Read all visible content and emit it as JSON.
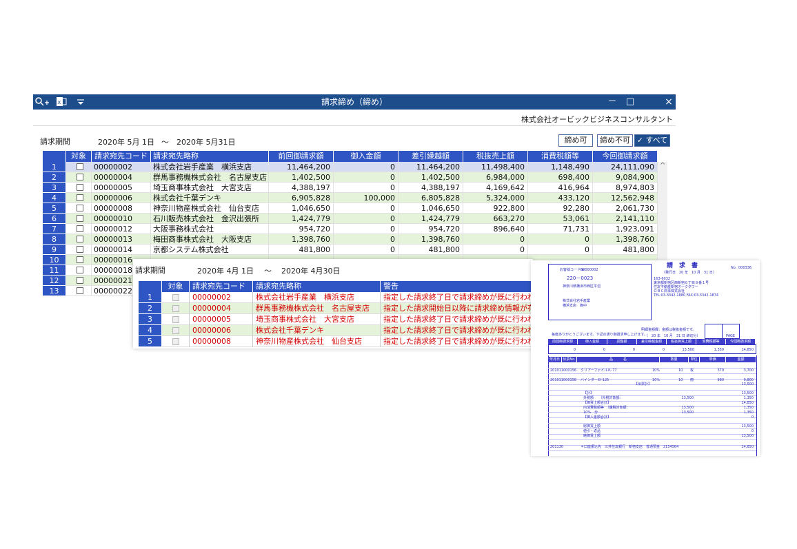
{
  "window": {
    "title": "請求締め（締め）",
    "company": "株式会社オービックビジネスコンサルタント",
    "period_label": "請求期間",
    "period_from": "2020年  5月  1日",
    "period_sep": "～",
    "period_to": "2020年  5月31日",
    "filters": [
      "締め可",
      "締め不可",
      "すべて"
    ],
    "filter_check": "✓",
    "icons": [
      "search-add-icon",
      "excel-icon",
      "dropdown-icon",
      "minimize-icon",
      "maximize-icon",
      "close-icon"
    ],
    "controls": {
      "minimize": "－",
      "maximize": "□",
      "close": "×"
    }
  },
  "grid": {
    "headers": [
      "対象",
      "請求宛先コード",
      "請求宛先略称",
      "前回御請求額",
      "御入金額",
      "差引繰越額",
      "税抜売上額",
      "消費税額等",
      "今回御請求額"
    ],
    "rows": [
      [
        "1",
        "00000002",
        "株式会社岩手産業　横浜支店",
        "11,464,200",
        "0",
        "11,464,200",
        "11,498,400",
        "1,148,490",
        "24,111,090"
      ],
      [
        "2",
        "00000004",
        "群馬事務機株式会社　名古屋支店",
        "1,402,500",
        "0",
        "1,402,500",
        "6,984,000",
        "698,400",
        "9,084,900"
      ],
      [
        "3",
        "00000005",
        "埼玉商事株式会社　大宮支店",
        "4,388,197",
        "0",
        "4,388,197",
        "4,169,642",
        "416,964",
        "8,974,803"
      ],
      [
        "4",
        "00000006",
        "株式会社千葉デンキ",
        "6,905,828",
        "100,000",
        "6,805,828",
        "5,324,000",
        "433,120",
        "12,562,948"
      ],
      [
        "5",
        "00000008",
        "神奈川物産株式会社　仙台支店",
        "1,046,650",
        "0",
        "1,046,650",
        "922,800",
        "92,280",
        "2,061,730"
      ],
      [
        "6",
        "00000010",
        "石川販売株式会社　金沢出張所",
        "1,424,779",
        "0",
        "1,424,779",
        "663,270",
        "53,061",
        "2,141,110"
      ],
      [
        "7",
        "00000012",
        "大阪事務株式会社",
        "954,720",
        "0",
        "954,720",
        "896,640",
        "71,731",
        "1,923,091"
      ],
      [
        "8",
        "00000013",
        "梅田商事株式会社　大阪支店",
        "1,398,760",
        "0",
        "1,398,760",
        "0",
        "0",
        "1,398,760"
      ],
      [
        "9",
        "00000014",
        "京都システム株式会社",
        "481,800",
        "0",
        "481,800",
        "0",
        "0",
        "481,800"
      ],
      [
        "10",
        "00000016",
        "",
        "",
        "",
        "",
        "",
        "",
        ""
      ],
      [
        "11",
        "00000018",
        "",
        "",
        "",
        "",
        "",
        "",
        ""
      ],
      [
        "12",
        "00000021",
        "",
        "",
        "",
        "",
        "",
        "",
        ""
      ],
      [
        "13",
        "00000022",
        "",
        "",
        "",
        "",
        "",
        "",
        ""
      ]
    ],
    "scroll_up": "^"
  },
  "warn": {
    "period_label": "請求期間",
    "period_from": "2020年  4月  1日",
    "period_sep": "～",
    "period_to": "2020年  4月30日",
    "headers": [
      "対象",
      "請求宛先コード",
      "請求宛先略称",
      "警告"
    ],
    "rows": [
      [
        "1",
        "00000002",
        "株式会社岩手産業　横浜支店",
        "指定した請求終了日で請求締めが既に行われ"
      ],
      [
        "2",
        "00000004",
        "群馬事務機株式会社　名古屋支店",
        "指定した請求開始日以降に請求締め情報が存"
      ],
      [
        "3",
        "00000005",
        "埼玉商事株式会社　大宮支店",
        "指定した請求終了日で請求締めが既に行われ"
      ],
      [
        "4",
        "00000006",
        "株式会社千葉デンキ",
        "指定した請求終了日で請求締めが既に行われ"
      ],
      [
        "5",
        "00000008",
        "神奈川物産株式会社　仙台支店",
        "指定した請求終了日で請求締めが既に行われ"
      ]
    ]
  },
  "invoice": {
    "title": "請　求　書",
    "no_label": "No.",
    "no_value": "000336",
    "customer_code_label": "お客様コード№",
    "customer_code": "00000002",
    "postal": "220－0023",
    "address": "神奈川県横浜市西区平沼",
    "customer_name": "株式会社岩手産業",
    "customer_branch": "横浜支店　御中",
    "issue_date": "（発行日　20 年　10 月　31 日）",
    "sender_postal": "163-6032",
    "sender_lines": [
      "東京都新宿区西新宿６丁目８番１号",
      "住友不動産新宿オークタワー",
      "ＯＢＣ商事株式会社",
      "TEL:03-3342-1880 FAX:03-3342-1874"
    ],
    "closing_note": "明細金額欄：金額は税抜金額です。",
    "thanks_note": "毎度ありがとうございます。下記の通り御請求申し上げます。",
    "closing_date": "（　20 年　10 月　31 日 締切分）",
    "page_label": "PAGE",
    "summary_headers": [
      "前回御請求額",
      "御入金額",
      "調整額",
      "差引繰越金額",
      "税抜御買上額",
      "消費税額等",
      "今回御請求額"
    ],
    "summary_values": [
      "0",
      "0",
      "0",
      "0",
      "13,500",
      "1,350",
      "14,850"
    ],
    "detail_headers": [
      "年月日",
      "伝票No.",
      "品　　　名",
      "数量",
      "単位",
      "単価",
      "金額"
    ],
    "details": [
      {
        "date": "201011",
        "slip": "000156",
        "name": "クリアーファイルＫ-77",
        "rate": "10%",
        "qty": "10",
        "unit": "枚",
        "price": "370",
        "amount": "3,700"
      },
      {
        "date": "201011",
        "slip": "000158",
        "name": "バインダーＢ-125",
        "rate": "10%",
        "qty": "10",
        "unit": "冊",
        "price": "980",
        "amount": "9,800"
      }
    ],
    "slip_total_label": "【伝票計】",
    "slip_total": "13,500",
    "sum_lines": [
      {
        "label": "【計】",
        "amount": "13,500"
      },
      {
        "label": "外税額　　（外税対象額：",
        "mid": "13,500",
        "amount": "1,350"
      },
      {
        "label": "【御買上額合計】",
        "amount": "14,850"
      },
      {
        "label": "内消費税額等　（課税対象額：",
        "mid": "13,500",
        "amount": "1,350"
      },
      {
        "label": "10%　分",
        "mid": "13,500",
        "amount": "1,350"
      },
      {
        "label": "【御入金額合計】",
        "amount": "0"
      },
      {
        "label": "総御買上額",
        "amount": "13,500"
      },
      {
        "label": "値引・返品",
        "amount": "0"
      },
      {
        "label": "純御買上額",
        "amount": "13,500"
      }
    ],
    "payment": {
      "date": "201130",
      "text": "＊口座振込先　三井住友銀行　新宿支店　普通預金　2154564",
      "amount": "14,850"
    }
  }
}
